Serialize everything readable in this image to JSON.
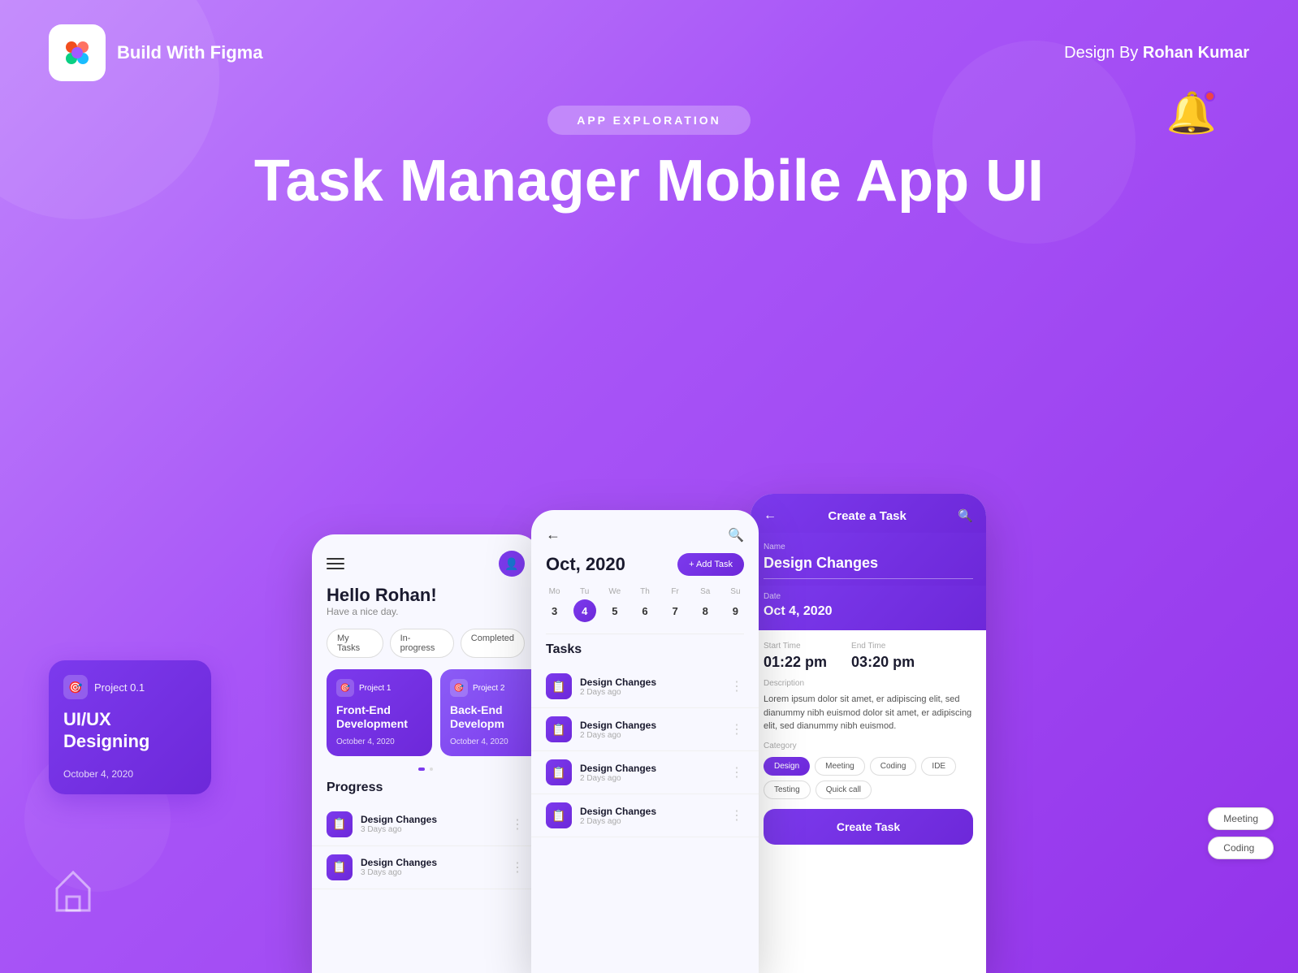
{
  "background": {
    "gradient_start": "#c084fc",
    "gradient_end": "#9333ea"
  },
  "header": {
    "logo_emoji": "🎨",
    "brand_name": "Build With\nFigma",
    "design_by_prefix": "Design By ",
    "designer_name": "Rohan Kumar"
  },
  "hero": {
    "badge_text": "APP EXPLORATION",
    "title": "Task Manager Mobile App UI"
  },
  "notification": {
    "has_dot": true
  },
  "floating_card": {
    "project_num": "Project 0.1",
    "project_icon": "🎯",
    "title": "UI/UX\nDesigning",
    "date": "October 4, 2020"
  },
  "phone1": {
    "greeting": "Hello Rohan!",
    "subtitle": "Have a nice day.",
    "tabs": [
      "My Tasks",
      "In-progress",
      "Completed"
    ],
    "projects": [
      {
        "num": "Project 1",
        "title": "Front-End\nDevelopment",
        "date": "October 4, 2020"
      },
      {
        "num": "Project 2",
        "title": "Back-End\nDevelopm",
        "date": "October 4, 2020"
      }
    ],
    "progress_title": "Progress",
    "tasks": [
      {
        "name": "Design Changes",
        "ago": "3 Days ago"
      },
      {
        "name": "Design Changes",
        "ago": "3 Days ago"
      }
    ]
  },
  "phone2": {
    "month": "Oct, 2020",
    "add_task_label": "+ Add Task",
    "calendar": [
      {
        "day": "Mo",
        "num": "3"
      },
      {
        "day": "Tu",
        "num": "4",
        "active": true
      },
      {
        "day": "We",
        "num": "5"
      },
      {
        "day": "Th",
        "num": "6"
      },
      {
        "day": "Fr",
        "num": "7"
      },
      {
        "day": "Sa",
        "num": "8"
      },
      {
        "day": "Su",
        "num": "9"
      }
    ],
    "tasks_title": "Tasks",
    "tasks": [
      {
        "name": "Design Changes",
        "ago": "2 Days ago"
      },
      {
        "name": "Design Changes",
        "ago": "2 Days ago"
      },
      {
        "name": "Design Changes",
        "ago": "2 Days ago"
      },
      {
        "name": "Design Changes",
        "ago": "2 Days ago"
      }
    ]
  },
  "phone3": {
    "header_title": "Create a Task",
    "name_label": "Name",
    "name_value": "Design Changes",
    "date_label": "Date",
    "date_value": "Oct 4, 2020",
    "start_time_label": "Start Time",
    "start_time_value": "01:22 pm",
    "end_time_label": "End Time",
    "end_time_value": "03:20 pm",
    "description_label": "Description",
    "description_text": "Lorem ipsum dolor sit amet, er adipiscing elit, sed dianummy nibh euismod  dolor sit amet, er adipiscing elit, sed dianummy nibh euismod.",
    "category_label": "Category",
    "categories": [
      {
        "name": "Design",
        "active": true
      },
      {
        "name": "Meeting",
        "active": false
      },
      {
        "name": "Coding",
        "active": false
      },
      {
        "name": "IDE",
        "active": false
      },
      {
        "name": "Testing",
        "active": false
      },
      {
        "name": "Quick call",
        "active": false
      }
    ],
    "extra_categories": [
      "Meeting",
      "Coding"
    ],
    "create_btn": "Create Task"
  }
}
